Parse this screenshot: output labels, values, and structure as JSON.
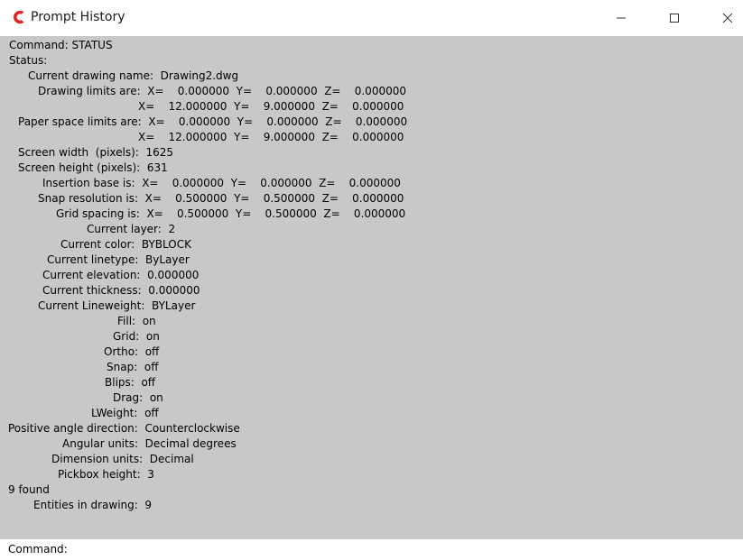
{
  "window": {
    "title": "Prompt History",
    "app_icon": "app-logo-icon",
    "accent_color": "#e02424",
    "controls": [
      "minimize-icon",
      "maximize-icon",
      "close-icon"
    ]
  },
  "history": {
    "background": "#c8c8c8",
    "lines": [
      "Command: STATUS",
      "Status:",
      "Current drawing name:  Drawing2.dwg",
      "Drawing limits are:  X=    0.000000  Y=    0.000000  Z=    0.000000",
      "X=    12.000000  Y=    9.000000  Z=    0.000000",
      "Paper space limits are:  X=    0.000000  Y=    0.000000  Z=    0.000000",
      "X=    12.000000  Y=    9.000000  Z=    0.000000",
      "Screen width  (pixels):  1625",
      "Screen height (pixels):  631",
      "Insertion base is:  X=    0.000000  Y=    0.000000  Z=    0.000000",
      "Snap resolution is:  X=    0.500000  Y=    0.500000  Z=    0.000000",
      "Grid spacing is:  X=    0.500000  Y=    0.500000  Z=    0.000000",
      "Current layer:  2",
      "Current color:  BYBLOCK",
      "Current linetype:  ByLayer",
      "Current elevation:  0.000000",
      "Current thickness:  0.000000",
      "Current Lineweight:  BYLayer",
      "Fill:  on",
      "Grid:  on",
      "Ortho:  off",
      "Snap:  off",
      "Blips:  off",
      "Drag:  on",
      "LWeight:  off",
      "Positive angle direction:  Counterclockwise",
      "Angular units:  Decimal degrees",
      "Dimension units:  Decimal",
      "Pickbox height:  3",
      "9 found",
      "Entities in drawing:  9"
    ]
  },
  "prompt": {
    "text": "Command:"
  }
}
